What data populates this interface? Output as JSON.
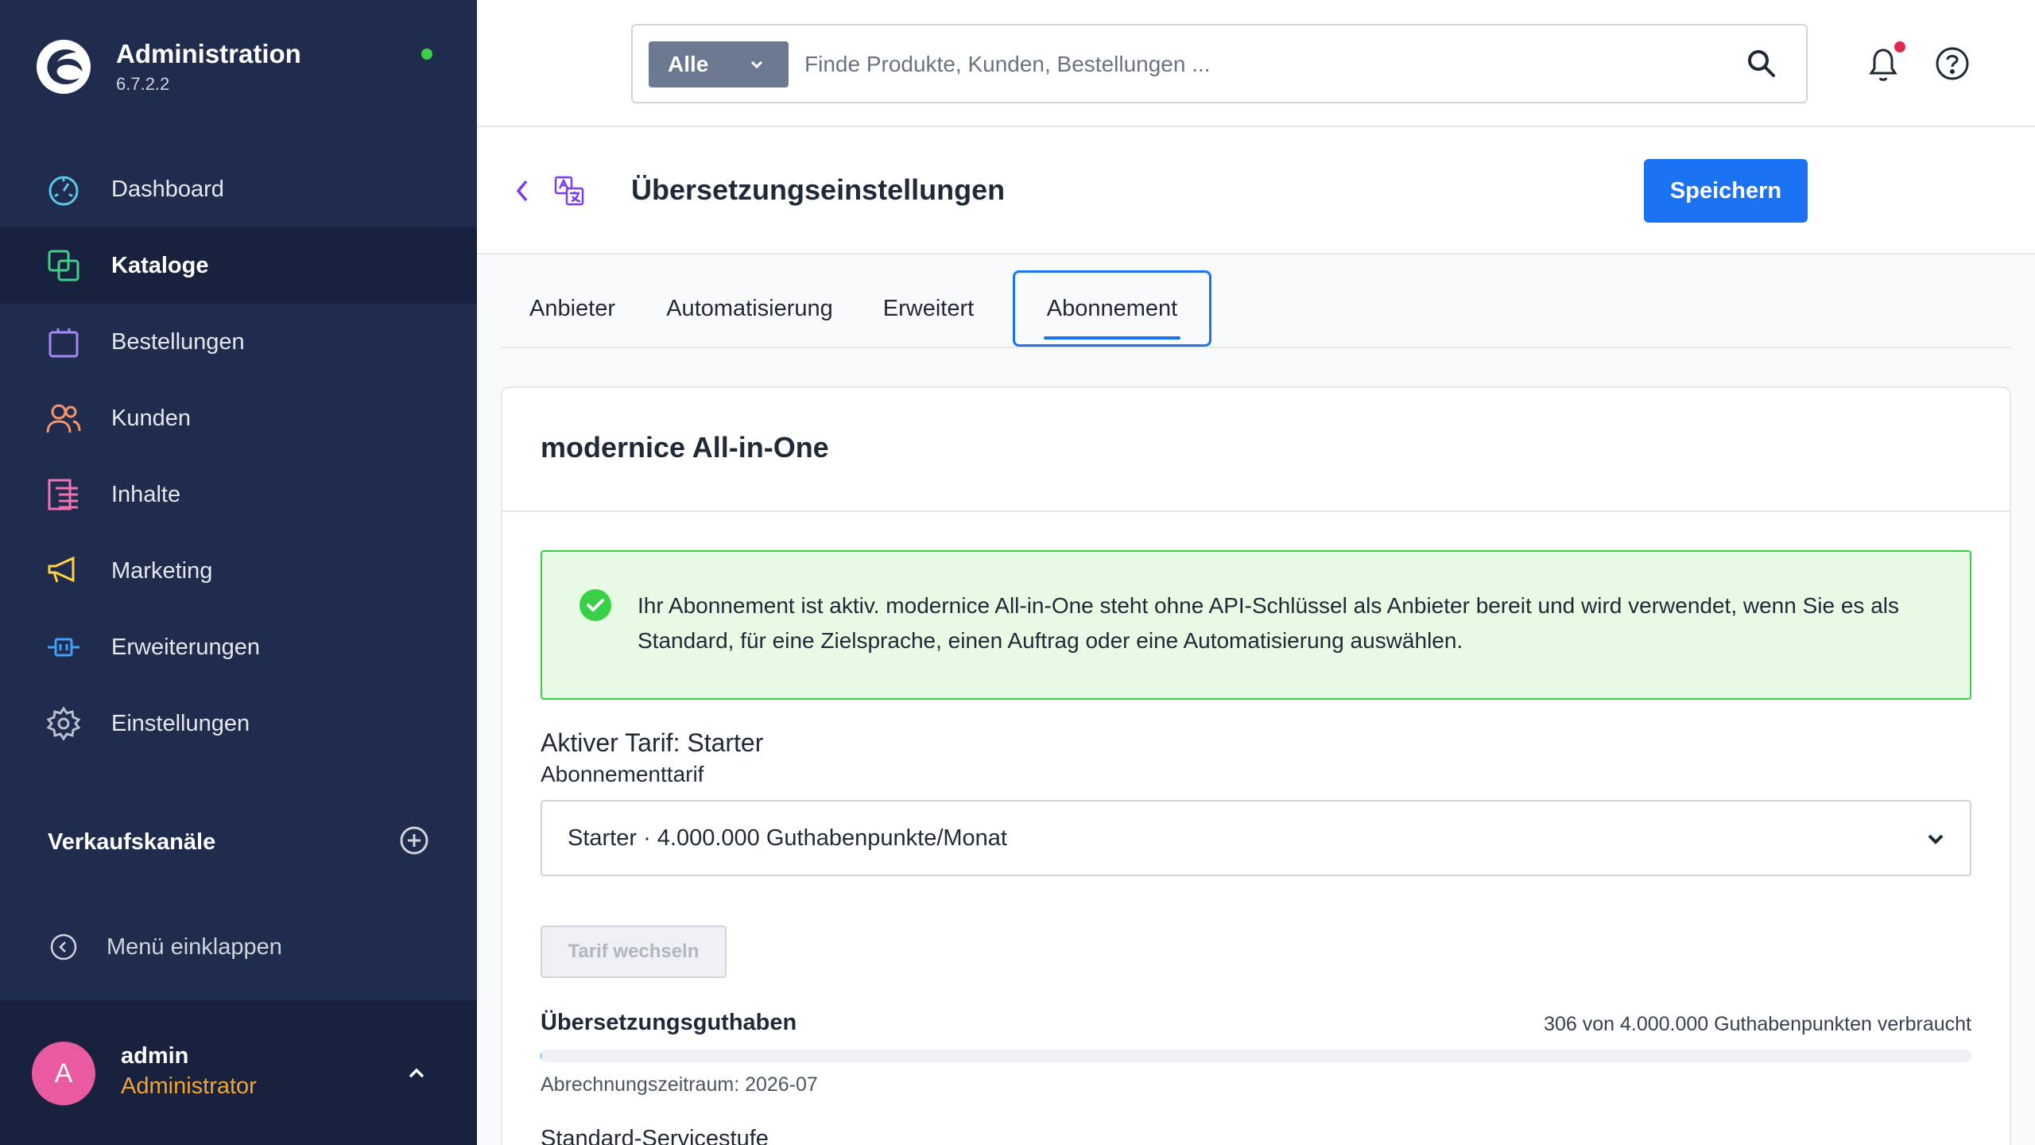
{
  "app": {
    "title": "Administration",
    "version": "6.7.2.2"
  },
  "nav": {
    "items": [
      {
        "label": "Dashboard",
        "icon": "dashboard-icon",
        "color": "#5dc6e8"
      },
      {
        "label": "Kataloge",
        "icon": "catalog-icon",
        "color": "#40d088"
      },
      {
        "label": "Bestellungen",
        "icon": "orders-icon",
        "color": "#a887f5"
      },
      {
        "label": "Kunden",
        "icon": "customers-icon",
        "color": "#f6956a"
      },
      {
        "label": "Inhalte",
        "icon": "content-icon",
        "color": "#ef72b3"
      },
      {
        "label": "Marketing",
        "icon": "marketing-icon",
        "color": "#ffd342"
      },
      {
        "label": "Erweiterungen",
        "icon": "extensions-icon",
        "color": "#3ea2f6"
      },
      {
        "label": "Einstellungen",
        "icon": "settings-icon",
        "color": "#b8c0cc"
      }
    ],
    "active_index": 1
  },
  "sales_channels": {
    "title": "Verkaufskanäle"
  },
  "collapse_label": "Menü einklappen",
  "user": {
    "initial": "A",
    "name": "admin",
    "role": "Administrator"
  },
  "search": {
    "type_label": "Alle",
    "placeholder": "Finde Produkte, Kunden, Bestellungen ..."
  },
  "page": {
    "title": "Übersetzungseinstellungen",
    "save_label": "Speichern"
  },
  "tabs": [
    {
      "label": "Anbieter"
    },
    {
      "label": "Automatisierung"
    },
    {
      "label": "Erweitert"
    },
    {
      "label": "Abonnement"
    }
  ],
  "active_tab": 3,
  "card": {
    "title": "modernice All-in-One",
    "alert": "Ihr Abonnement ist aktiv. modernice All-in-One steht ohne API-Schlüssel als Anbieter bereit und wird verwendet, wenn Sie es als Standard, für eine Zielsprache, einen Auftrag oder eine Automatisierung auswählen.",
    "plan_title": "Aktiver Tarif: Starter",
    "plan_label": "Abonnementtarif",
    "plan_value": "Starter · 4.000.000 Guthabenpunkte/Monat",
    "switch_label": "Tarif wechseln",
    "credit_title": "Übersetzungsguthaben",
    "credit_usage": "306 von 4.000.000 Guthabenpunkten verbraucht",
    "credit_used": 306,
    "credit_total": 4000000,
    "billing_period": "Abrechnungszeitraum: 2026-07",
    "service_level_label": "Standard-Servicestufe"
  },
  "colors": {
    "sidebar_bg": "#1f2c4e",
    "primary": "#1b72f2",
    "success": "#37d046",
    "user_role": "#f0a530",
    "avatar": "#ea5aa0"
  }
}
